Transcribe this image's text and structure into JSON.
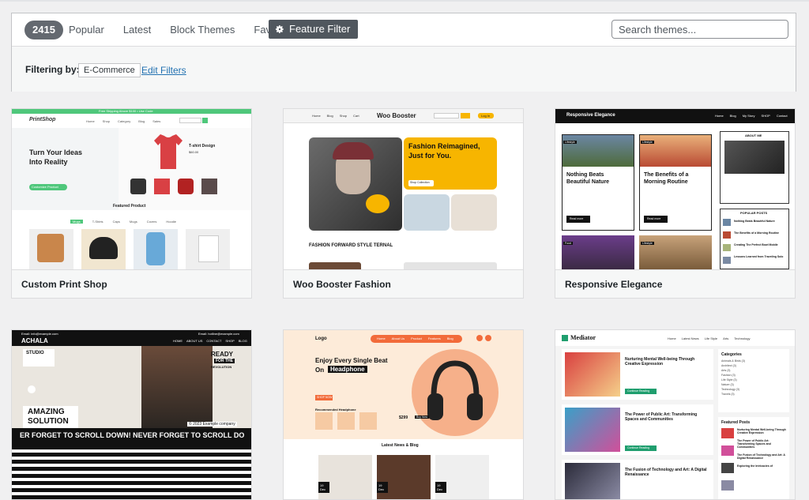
{
  "filter_bar": {
    "count": "2415",
    "nav": [
      {
        "label": "Popular"
      },
      {
        "label": "Latest"
      },
      {
        "label": "Block Themes"
      },
      {
        "label": "Favorites"
      }
    ],
    "feature_filter_label": "Feature Filter",
    "search_placeholder": "Search themes..."
  },
  "filtering": {
    "label": "Filtering by:",
    "tag": "E-Commerce",
    "edit_label": "Edit Filters"
  },
  "themes": [
    {
      "name": "Custom Print Shop",
      "preview": {
        "topbar": "Free Shipping Above $100 • Use Code",
        "logo": "PrintShop",
        "nav": [
          "Home",
          "Shop",
          "Category",
          "Blog",
          "Sales"
        ],
        "hero_title_1": "Turn Your Ideas",
        "hero_title_2": "Into Reality",
        "hero_btn": "Customize Product",
        "product_title": "T-shirt Design",
        "price": "$60.00",
        "featured_heading": "Featured Product",
        "filter_tabs": [
          "Mugs",
          "T-Shirts",
          "Caps",
          "Mugs",
          "Covers",
          "Hoodie"
        ]
      }
    },
    {
      "name": "Woo Booster Fashion",
      "preview": {
        "logo": "Woo Booster",
        "nav": [
          "Home",
          "Blog",
          "Shop",
          "Cart"
        ],
        "login": "Log In",
        "hero_title_1": "Fashion Reimagined,",
        "hero_title_2": "Just for You.",
        "shop_btn": "Shop Collection",
        "sale_label": "SHOP NOW",
        "section_title": "FASHION FORWARD STYLE TERNAL"
      }
    },
    {
      "name": "Responsive Elegance",
      "preview": {
        "logo": "Responsive Elegance",
        "nav": [
          "Home",
          "Blog",
          "My Story",
          "SHOP",
          "Contact"
        ],
        "post1_tag": "Lifestyle",
        "post1_title_1": "Nothing Beats",
        "post1_title_2": "Beautiful Nature",
        "post2_tag": "Lifestyle",
        "post2_title_1": "The Benefits of a",
        "post2_title_2": "Morning Routine",
        "read_more": "Read more",
        "about_heading": "ABOUT ME",
        "popular_heading": "POPULAR POSTS",
        "popular": [
          "Nothing Beats Beautiful Nature",
          "The Benefits of a Morning Routine",
          "Creating The Perfect Bowl Mobile",
          "Lessons Learned from Traveling Solo"
        ],
        "food_tag": "Food",
        "lifestyle_tag": "Lifestyle"
      }
    },
    {
      "name": "Achala",
      "preview": {
        "email_left": "Email: info@example.com",
        "email_right": "Email: hotline@example.com",
        "logo": "ACHALA",
        "nav": [
          "HOME",
          "ABOUT US",
          "CONTACT",
          "SHOP",
          "BLOG"
        ],
        "studio": "STUDIO",
        "ready_1": "READY",
        "ready_2": "FOR THE",
        "ready_3": "REVOLUTION",
        "amazing_1": "AMAZING",
        "amazing_2": "SOLUTION",
        "copyright": "© 2023 Example company",
        "marquee": "ER FORGET TO SCROLL DOWN! NEVER FORGET TO SCROLL DO"
      }
    },
    {
      "name": "Headphone",
      "preview": {
        "logo": "Logo",
        "nav": [
          "Home",
          "About Us",
          "Product",
          "Features",
          "Blog"
        ],
        "hero_title_1": "Enjoy Every Single Beat",
        "hero_title_2": "On",
        "hero_highlight": "Headphone",
        "hero_btn": "SHOP NOW",
        "rec_label": "Recommended Headphone",
        "price": "$299",
        "price_btn": "Buy Now",
        "news_heading": "Latest News & Blog",
        "date1": "19 Dec",
        "date2": "19 Dec",
        "date3": "19 Dec"
      }
    },
    {
      "name": "Mediator",
      "preview": {
        "logo": "Mediator",
        "nav": [
          "Home",
          "Latest News",
          "Life Style",
          "Arts",
          "Technology"
        ],
        "post1_title": "Nurturing Mental Well-being Through Creative Expression",
        "post2_title": "The Power of Public Art: Transforming Spaces and Communities",
        "post3_title": "The Fusion of Technology and Art: A Digital Renaissance",
        "continue": "Continue Reading",
        "categories_heading": "Categories",
        "categories": [
          "Animals & Birds (3)",
          "Architect (3)",
          "Arts (3)",
          "Fashion (3)",
          "Life Style (3)",
          "Nature (3)",
          "Technology (3)",
          "Travels (3)"
        ],
        "featured_heading": "Featured Posts",
        "featured": [
          "Nurturing Mental Well-being Through Creative Expression",
          "The Power of Public Art: Transforming Spaces and Communities",
          "The Fusion of Technology and Art: A Digital Renaissance",
          "Exploring the Intricacies of"
        ]
      }
    }
  ]
}
